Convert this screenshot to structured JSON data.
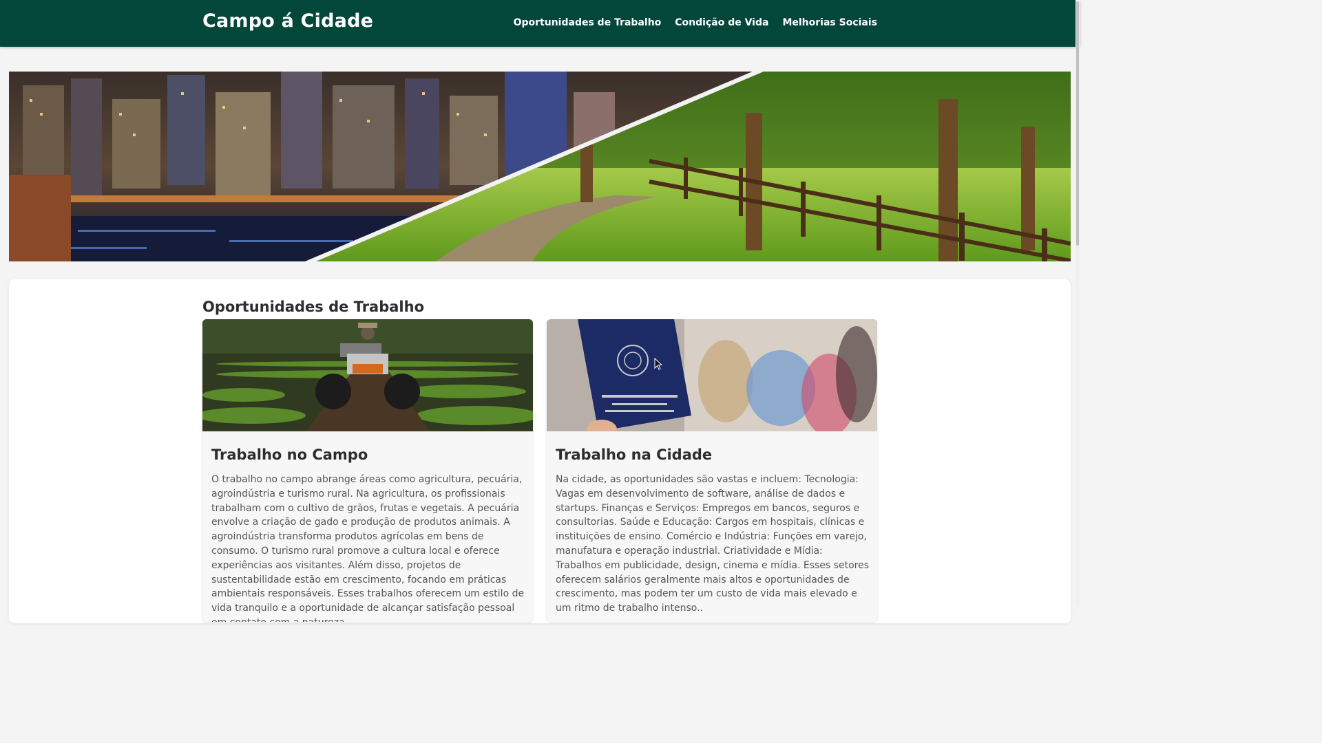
{
  "header": {
    "brand": "Campo á Cidade",
    "nav": [
      "Oportunidades de Trabalho",
      "Condição de Vida",
      "Melhorias Sociais"
    ]
  },
  "hero": {
    "image": "city-night-and-countryside-split-photo"
  },
  "section": {
    "title": "Oportunidades de Trabalho"
  },
  "cards": [
    {
      "image": "tractor-in-field-photo",
      "title": "Trabalho no Campo",
      "text": "O trabalho no campo abrange áreas como agricultura, pecuária, agroindústria e turismo rural. Na agricultura, os profissionais trabalham com o cultivo de grãos, frutas e vegetais. A pecuária envolve a criação de gado e produção de produtos animais. A agroindústria transforma produtos agrícolas em bens de consumo. O turismo rural promove a cultura local e oferece experiências aos visitantes. Além disso, projetos de sustentabilidade estão em crescimento, focando em práticas ambientais responsáveis. Esses trabalhos oferecem um estilo de vida tranquilo e a oportunidade de alcançar satisfação pessoal em contato com a natureza."
    },
    {
      "image": "work-card-booklet-photo",
      "title": "Trabalho na Cidade",
      "text": "Na cidade, as oportunidades são vastas e incluem: Tecnologia: Vagas em desenvolvimento de software, análise de dados e startups. Finanças e Serviços: Empregos em bancos, seguros e consultorias. Saúde e Educação: Cargos em hospitais, clínicas e instituições de ensino. Comércio e Indústria: Funções em varejo, manufatura e operação industrial. Criatividade e Mídia: Trabalhos em publicidade, design, cinema e mídia. Esses setores oferecem salários geralmente mais altos e oportunidades de crescimento, mas podem ter um custo de vida mais elevado e um ritmo de trabalho intenso.."
    }
  ],
  "colors": {
    "header_bg": "#03473a",
    "page_bg": "#f4f4f4"
  }
}
